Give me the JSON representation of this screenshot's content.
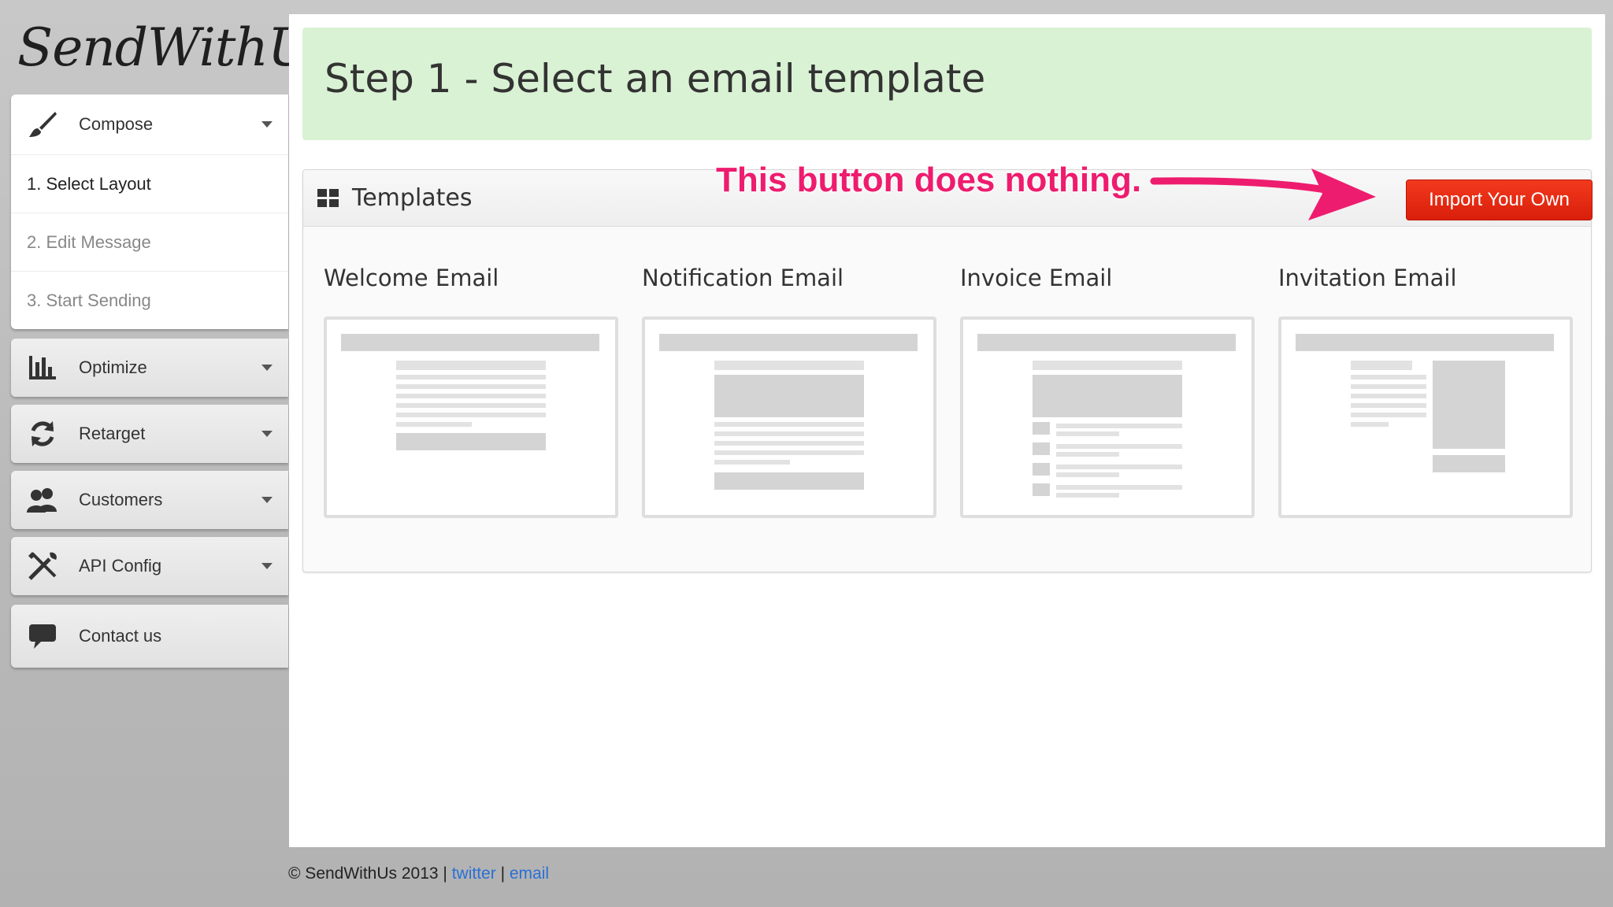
{
  "app": {
    "logo_text": "SendWithUs"
  },
  "sidebar": {
    "compose": {
      "label": "Compose",
      "icon": "paintbrush-icon",
      "steps": [
        "1. Select Layout",
        "2. Edit Message",
        "3. Start Sending"
      ]
    },
    "items": [
      {
        "label": "Optimize",
        "icon": "bar-chart-icon",
        "has_caret": true
      },
      {
        "label": "Retarget",
        "icon": "refresh-icon",
        "has_caret": true
      },
      {
        "label": "Customers",
        "icon": "users-icon",
        "has_caret": true
      },
      {
        "label": "API Config",
        "icon": "tools-icon",
        "has_caret": true
      },
      {
        "label": "Contact us",
        "icon": "chat-bubble-icon",
        "has_caret": false
      }
    ]
  },
  "main": {
    "step_title": "Step 1 - Select an email template",
    "templates": {
      "title": "Templates",
      "annotation": "This button does nothing.",
      "import_button": "Import Your Own",
      "items": [
        {
          "name": "Welcome Email"
        },
        {
          "name": "Notification Email"
        },
        {
          "name": "Invoice Email"
        },
        {
          "name": "Invitation Email"
        }
      ]
    }
  },
  "footer": {
    "copyright": "© SendWithUs 2013 |",
    "twitter": "twitter",
    "separator": "|",
    "email": "email"
  },
  "colors": {
    "banner_green": "#d9f2d4",
    "import_red": "#e42a12",
    "annotation_pink": "#ee1c6e",
    "link_blue": "#2a6fd6"
  }
}
